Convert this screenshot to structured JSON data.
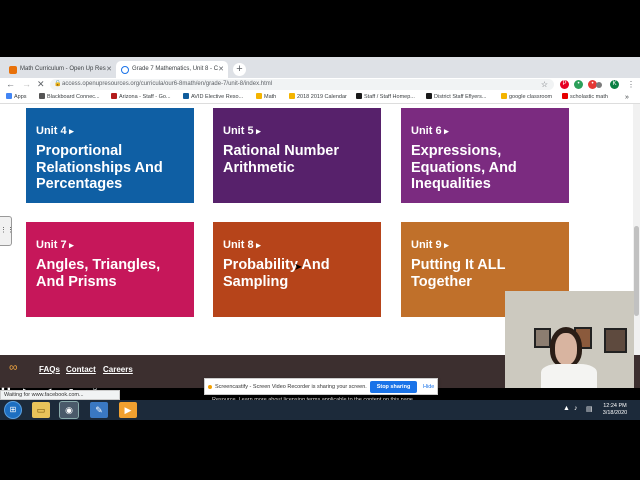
{
  "browser": {
    "tabs": [
      {
        "title": "Math Curriculum - Open Up Res",
        "favicon_color": "#e8710a"
      },
      {
        "title": "Grade 7 Mathematics, Unit 8 - C",
        "favicon_color": "#1a73e8"
      }
    ],
    "address": "access.openupresources.org/curricula/our6-8math/en/grade-7/unit-8/index.html",
    "profile_initial": "K",
    "bookmarks": [
      {
        "label": "Apps",
        "color": "#4285f4"
      },
      {
        "label": "Blackboard Connec...",
        "color": "#555555"
      },
      {
        "label": "Arizona - Staff - Go...",
        "color": "#b31b1b"
      },
      {
        "label": "AVID Elective Reso...",
        "color": "#0f5c9c"
      },
      {
        "label": "Math",
        "color": "#f4b400"
      },
      {
        "label": "2018 2019 Calendar",
        "color": "#f4b400"
      },
      {
        "label": "Staff / Staff Homep...",
        "color": "#1a1a1a"
      },
      {
        "label": "District Staff Eflyers...",
        "color": "#1a1a1a"
      },
      {
        "label": "google classroom",
        "color": "#f4b400"
      },
      {
        "label": "scholastic math",
        "color": "#e60000"
      }
    ]
  },
  "units": [
    {
      "unit": "Unit 4",
      "title": "Proportional Relationships And Percentages",
      "color": "#0f5fa4"
    },
    {
      "unit": "Unit 5",
      "title": "Rational Number Arithmetic",
      "color": "#57216b"
    },
    {
      "unit": "Unit 6",
      "title": "Expressions, Equations, And Inequalities",
      "color": "#7b2b80"
    },
    {
      "unit": "Unit 7",
      "title": "Angles, Triangles, And Prisms",
      "color": "#c6175a"
    },
    {
      "unit": "Unit 8",
      "title": "Probability And Sampling",
      "color": "#b6441a"
    },
    {
      "unit": "Unit 9",
      "title": "Putting It ALL Together",
      "color": "#c0702a"
    }
  ],
  "footer": {
    "links": [
      "FAQs",
      "Contact",
      "Careers"
    ],
    "notice": "Resource. Learn more about licensing terms applicable to the content on this page."
  },
  "status_text": "Waiting for www.facebook.com...",
  "screencastify": {
    "message": "Screencastify - Screen Video Recorder is sharing your screen.",
    "stop_label": "Stop sharing",
    "hide_label": "Hide"
  },
  "taskbar": {
    "time": "12:24 PM",
    "date": "3/18/2020"
  }
}
